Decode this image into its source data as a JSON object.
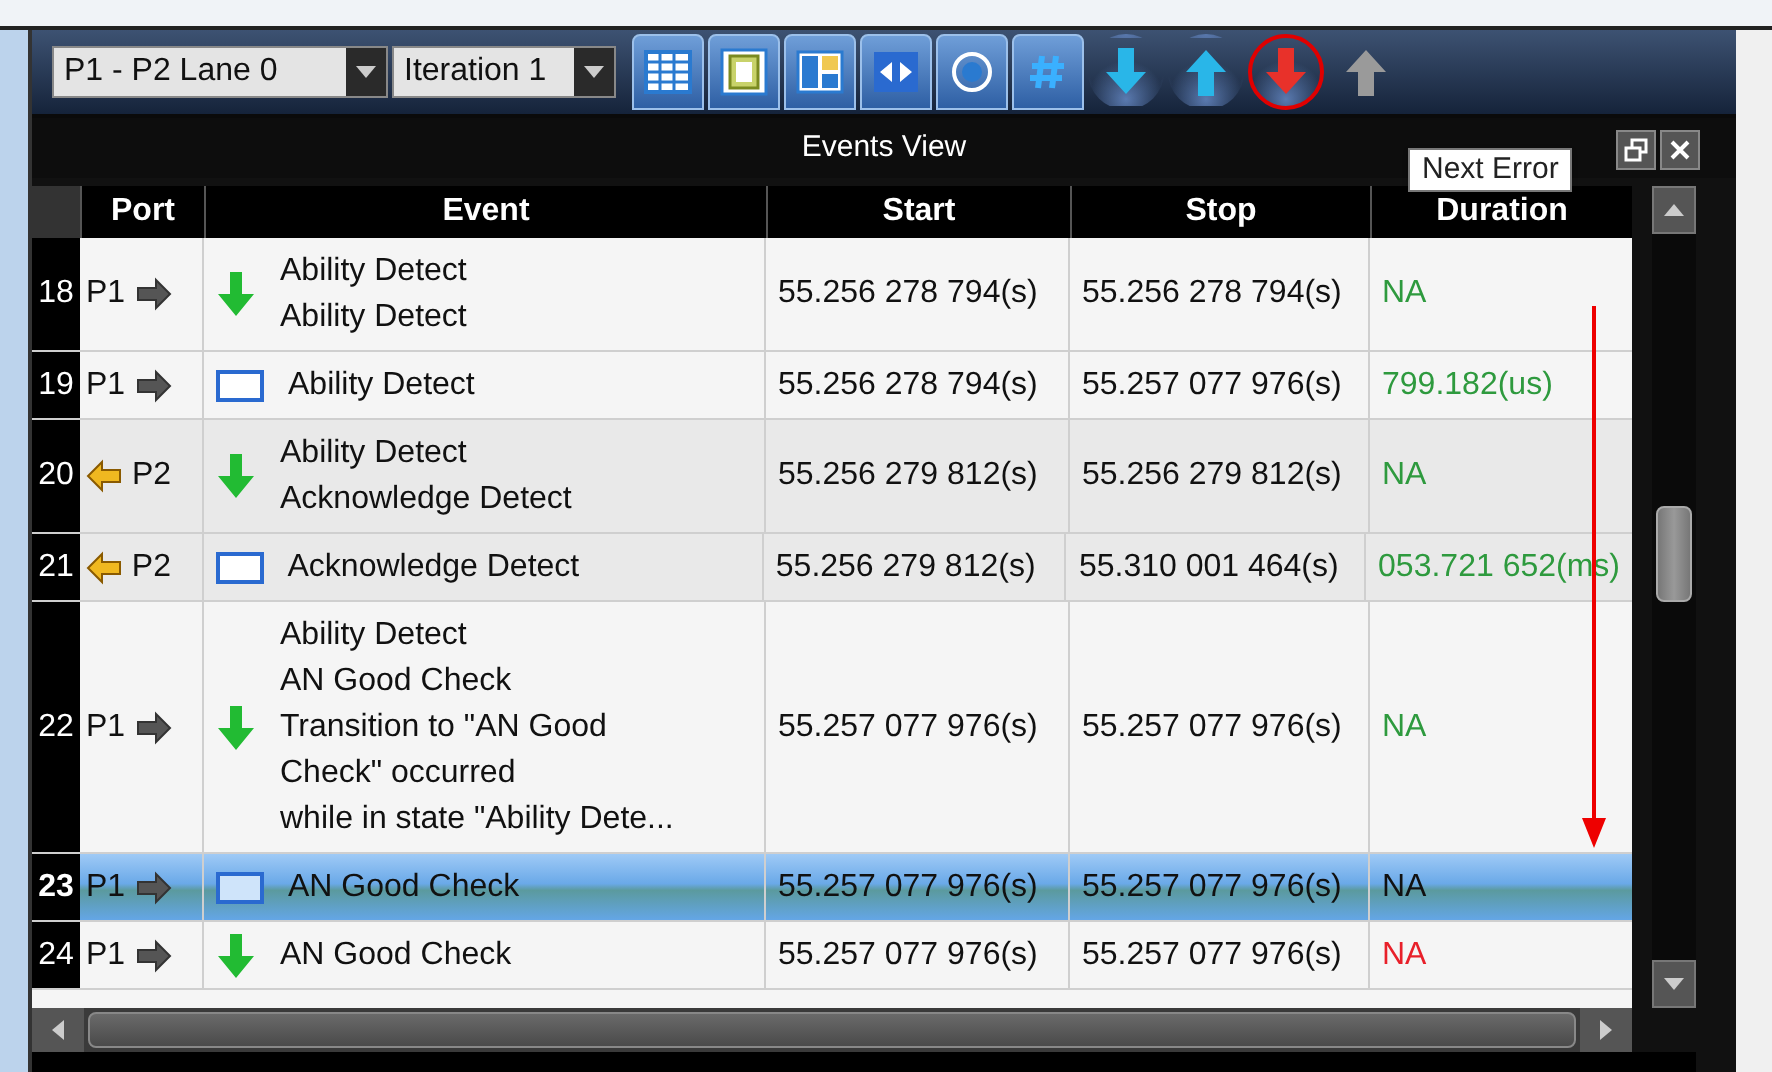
{
  "toolbar": {
    "selectors": [
      {
        "value": "P1 - P2 Lane 0"
      },
      {
        "value": "Iteration 1"
      }
    ],
    "view_buttons": [
      {
        "kind": "grid"
      },
      {
        "kind": "frame"
      },
      {
        "kind": "panes"
      },
      {
        "kind": "swap"
      },
      {
        "kind": "ring"
      },
      {
        "kind": "hash"
      }
    ],
    "nav_buttons": [
      {
        "kind": "down",
        "color": "#29b6e8",
        "disabled": false,
        "circled": false
      },
      {
        "kind": "up",
        "color": "#29b6e8",
        "disabled": false,
        "circled": false
      },
      {
        "kind": "down",
        "color": "#e8312a",
        "disabled": false,
        "circled": true
      },
      {
        "kind": "up",
        "color": "#9a9a9a",
        "disabled": true,
        "circled": false
      }
    ],
    "tooltip": "Next Error"
  },
  "panel": {
    "title": "Events View"
  },
  "table": {
    "columns": [
      "Port",
      "Event",
      "Start",
      "Stop",
      "Duration"
    ],
    "rows": [
      {
        "number": "18",
        "port": "P1",
        "incoming": false,
        "transition": true,
        "event": [
          "Ability Detect",
          "Ability Detect"
        ],
        "start": "55.256 278 794(s)",
        "stop": "55.256 278 794(s)",
        "duration": "NA",
        "error": false,
        "shaded": false,
        "selected": false
      },
      {
        "number": "19",
        "port": "P1",
        "incoming": false,
        "transition": false,
        "event": [
          "Ability Detect"
        ],
        "start": "55.256 278 794(s)",
        "stop": "55.257 077 976(s)",
        "duration": "799.182(us)",
        "error": false,
        "shaded": false,
        "selected": false
      },
      {
        "number": "20",
        "port": "P2",
        "incoming": true,
        "transition": true,
        "event": [
          "Ability Detect",
          "Acknowledge Detect"
        ],
        "start": "55.256 279 812(s)",
        "stop": "55.256 279 812(s)",
        "duration": "NA",
        "error": false,
        "shaded": true,
        "selected": false
      },
      {
        "number": "21",
        "port": "P2",
        "incoming": true,
        "transition": false,
        "event": [
          "Acknowledge Detect"
        ],
        "start": "55.256 279 812(s)",
        "stop": "55.310 001 464(s)",
        "duration": "053.721 652(ms)",
        "error": false,
        "shaded": true,
        "selected": false
      },
      {
        "number": "22",
        "port": "P1",
        "incoming": false,
        "transition": true,
        "event": [
          "Ability Detect",
          "AN Good Check",
          "Transition to \"AN Good",
          "Check\" occurred",
          "while in state \"Ability Dete..."
        ],
        "start": "55.257 077 976(s)",
        "stop": "55.257 077 976(s)",
        "duration": "NA",
        "error": false,
        "shaded": false,
        "selected": false
      },
      {
        "number": "23",
        "port": "P1",
        "incoming": false,
        "transition": false,
        "event": [
          "AN Good Check"
        ],
        "start": "55.257 077 976(s)",
        "stop": "55.257 077 976(s)",
        "duration": "NA",
        "error": false,
        "shaded": false,
        "selected": true
      },
      {
        "number": "24",
        "port": "P1",
        "incoming": false,
        "transition": true,
        "event": [
          "AN Good Check"
        ],
        "start": "55.257 077 976(s)",
        "stop": "55.257 077 976(s)",
        "duration": "NA",
        "error": true,
        "shaded": false,
        "selected": false
      }
    ]
  }
}
